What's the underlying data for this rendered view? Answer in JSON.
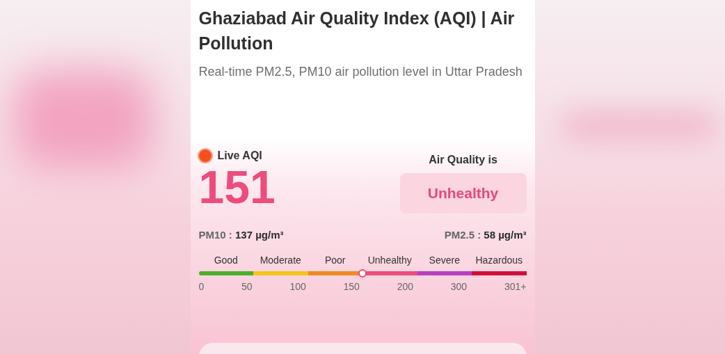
{
  "title": "Ghaziabad Air Quality Index (AQI) | Air Pollution",
  "subtitle": "Real-time PM2.5, PM10 air pollution level in Uttar Pradesh",
  "live_label": "Live AQI",
  "aqi": "151",
  "status_label": "Air Quality is",
  "status": "Unhealthy",
  "pollutants": [
    {
      "label": "PM10 :",
      "value": "137 µg/m³"
    },
    {
      "label": "PM2.5 :",
      "value": "58 µg/m³"
    }
  ],
  "scale": {
    "level": 0.5,
    "bands": [
      {
        "label": "Good",
        "color": "#4caf2a"
      },
      {
        "label": "Moderate",
        "color": "#f5c518"
      },
      {
        "label": "Poor",
        "color": "#f08a24"
      },
      {
        "label": "Unhealthy",
        "color": "#ec4d7c"
      },
      {
        "label": "Severe",
        "color": "#b83fc0"
      },
      {
        "label": "Hazardous",
        "color": "#d0103a"
      }
    ],
    "ticks": [
      "0",
      "50",
      "100",
      "150",
      "200",
      "300",
      "301+"
    ]
  }
}
